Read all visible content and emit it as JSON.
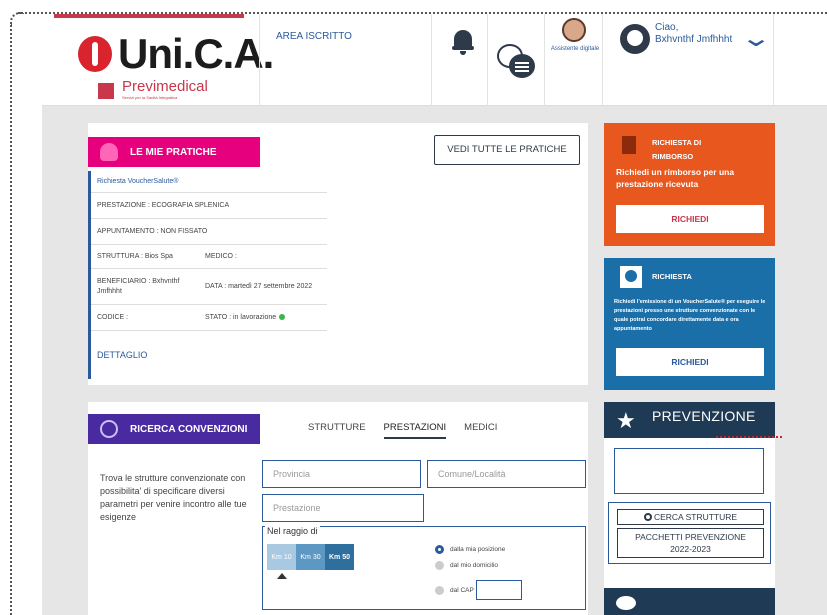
{
  "header": {
    "logo_text": "Uni.C.A.",
    "sub_logo_text": "Previmedical",
    "sub_logo_tagline": "Servizi per la Sanità Integrativa",
    "area_link": "AREA ISCRITTO",
    "assistant_label": "Assistente digitale",
    "greeting_line1": "Ciao,",
    "greeting_line2": "Bxhvnthf Jmfhhht"
  },
  "pratiche": {
    "tag_label": "LE MIE PRATICHE",
    "view_all_button": "VEDI TUTTE LE PRATICHE",
    "request_title": "Richiesta VoucherSalute®",
    "prestazione": "PRESTAZIONE :  ECOGRAFIA SPLENICA",
    "appuntamento": "APPUNTAMENTO :  NON FISSATO",
    "struttura": "STRUTTURA :  Bios Spa",
    "medico": "MEDICO :",
    "beneficiario": "BENEFICIARIO :  Bxhvnthf Jmfhhht",
    "data": "DATA :  martedì 27 settembre 2022",
    "codice": "CODICE :",
    "stato": "STATO :  in lavorazione",
    "dettaglio": "DETTAGLIO",
    "status_color": "#3ab54a"
  },
  "ricerca": {
    "tag_label": "RICERCA CONVENZIONI",
    "tabs": [
      "STRUTTURE",
      "PRESTAZIONI",
      "MEDICI"
    ],
    "active_tab": "PRESTAZIONI",
    "description": "Trova le strutture convenzionate con possibilita' di specificare diversi parametri per venire incontro alle tue esigenze",
    "provincia_placeholder": "Provincia",
    "comune_placeholder": "Comune/Località",
    "prestazione_placeholder": "Prestazione",
    "raggio_label": "Nel raggio di",
    "km_options": [
      "Km 10",
      "Km 30",
      "Km 50"
    ],
    "radio_options": [
      "dalla mia posizione",
      "dal mio domicilio",
      "dal CAP"
    ],
    "selected_radio": "dalla mia posizione"
  },
  "rimborso": {
    "title_line1": "RICHIESTA DI",
    "title_line2": "RIMBORSO",
    "subtitle": "Richiedi un rimborso per una prestazione ricevuta",
    "button": "RICHIEDI",
    "color": "#e8571e"
  },
  "voucher": {
    "title": "RICHIESTA",
    "subtitle": "Richiedi l'emissione di un VoucherSalute® per eseguire le prestazioni presso une strutture convenzionate con le quale potrai concordare direttamente data e ora appuntamento",
    "button": "RICHIEDI",
    "color": "#1a6fa8"
  },
  "prevenzione": {
    "title": "PREVENZIONE",
    "search_button": "CERCA STRUTTURE",
    "packages_line1": "PACCHETTI PREVENZIONE",
    "packages_line2": "2022-2023"
  }
}
